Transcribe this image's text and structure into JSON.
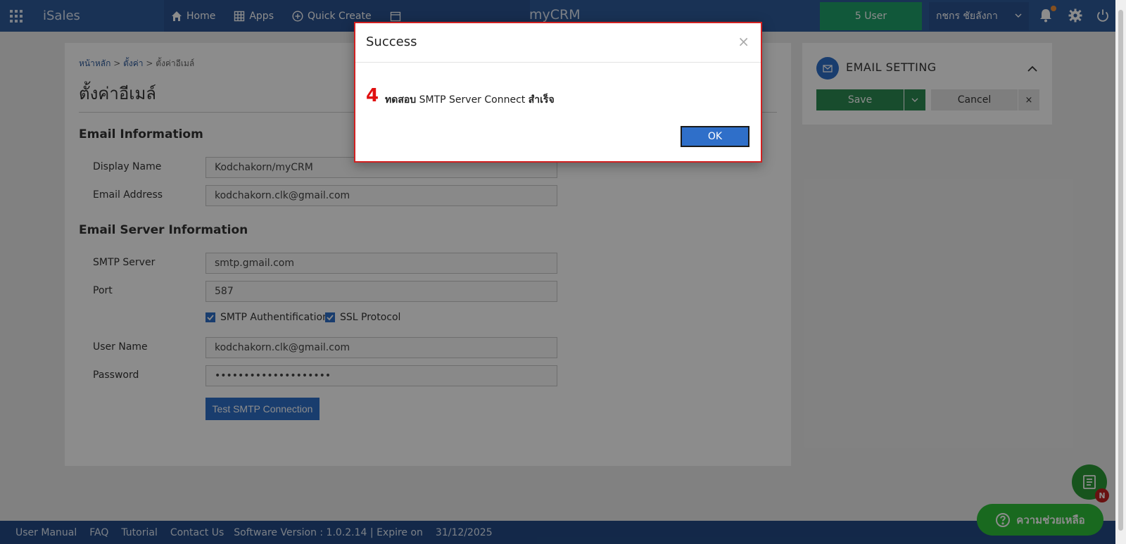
{
  "topbar": {
    "brand": "iSales",
    "nav": [
      {
        "label": "Home",
        "icon": "home-icon"
      },
      {
        "label": "Apps",
        "icon": "apps-icon"
      },
      {
        "label": "Quick Create",
        "icon": "plus-circle-icon"
      }
    ],
    "logo": "myCRM",
    "user_count": "5 User",
    "user_name": "กชกร ชัยลังกา"
  },
  "breadcrumb": {
    "home": "หน้าหลัก",
    "settings": "ตั้งค่า",
    "current": "ตั้งค่าอีเมล์"
  },
  "page_title": "ตั้งค่าอีเมล์",
  "email_info": {
    "section_title": "Email Informatiom",
    "display_name_label": "Display Name",
    "display_name_value": "Kodchakorn/myCRM",
    "email_label": "Email Address",
    "email_value": "kodchakorn.clk@gmail.com"
  },
  "server_info": {
    "section_title": "Email Server Information",
    "smtp_label": "SMTP Server",
    "smtp_value": "smtp.gmail.com",
    "port_label": "Port",
    "port_value": "587",
    "smtp_auth_label": "SMTP Authentification",
    "ssl_label": "SSL Protocol",
    "username_label": "User Name",
    "username_value": "kodchakorn.clk@gmail.com",
    "password_label": "Password",
    "password_value": "••••••••••••••••••••",
    "test_button": "Test SMTP Connection"
  },
  "side_panel": {
    "title": "EMAIL SETTING",
    "save": "Save",
    "cancel": "Cancel",
    "close_x": "×"
  },
  "footer": {
    "links": [
      "User Manual",
      "FAQ",
      "Tutorial",
      "Contact Us"
    ],
    "version": "Software Version : 1.0.2.14 | Expire on",
    "expire_date": "31/12/2025"
  },
  "floating": {
    "badge": "N",
    "help": "ความช่วยเหลือ"
  },
  "modal": {
    "title": "Success",
    "close": "×",
    "step": "4",
    "msg_prefix": "ทดสอบ",
    "msg_middle": " SMTP Server Connect ",
    "msg_suffix": "สำเร็จ",
    "ok": "OK"
  },
  "colors": {
    "topbar": "#2f5b9c",
    "accent_green": "#1fa16a",
    "primary_blue": "#2f6fc9",
    "footer": "#234a85",
    "modal_border": "#d12020"
  }
}
